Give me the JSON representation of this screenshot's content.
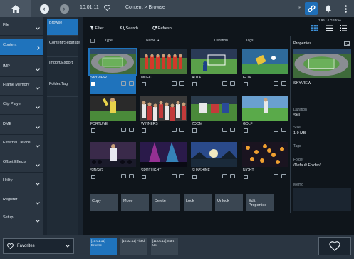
{
  "topbar": {
    "favorite_path": "10:01.11",
    "title": "Content > Browse",
    "ip_label": "IP"
  },
  "leftnav": {
    "items": [
      {
        "label": "File",
        "active": false
      },
      {
        "label": "Content",
        "active": true
      },
      {
        "label": "IMP",
        "active": false
      },
      {
        "label": "Frame Memory",
        "active": false
      },
      {
        "label": "Clip Player",
        "active": false
      },
      {
        "label": "DME",
        "active": false
      },
      {
        "label": "External Device",
        "active": false
      },
      {
        "label": "Offset Effects",
        "active": false
      },
      {
        "label": "Utility",
        "active": false
      },
      {
        "label": "Register",
        "active": false
      },
      {
        "label": "Setup",
        "active": false
      }
    ]
  },
  "subnav": {
    "items": [
      {
        "label": "Browse",
        "active": true
      },
      {
        "label": "Content/Separate",
        "active": false
      },
      {
        "label": "Import/Export",
        "active": false
      },
      {
        "label": "Folder/Tag",
        "active": false
      }
    ]
  },
  "toolbar": {
    "filter_label": "Filter",
    "search_label": "Search",
    "refresh_label": "Refresh",
    "storage_label": "1.96 / 4 GB free"
  },
  "columns": {
    "type": "Type",
    "name": "Name",
    "duration": "Duration",
    "tags": "Tags"
  },
  "tiles": [
    {
      "name": "SKYVIEW",
      "selected": true,
      "scene": "stadium"
    },
    {
      "name": "MUFC",
      "selected": false,
      "scene": "team"
    },
    {
      "name": "AUTA",
      "selected": false,
      "scene": "goal"
    },
    {
      "name": "GOAL",
      "selected": false,
      "scene": "keeper"
    },
    {
      "name": "FORTUNE",
      "selected": false,
      "scene": "cheer"
    },
    {
      "name": "WINNERS",
      "selected": false,
      "scene": "crowd"
    },
    {
      "name": "ZOOM",
      "selected": false,
      "scene": "tackle"
    },
    {
      "name": "GOLF",
      "selected": false,
      "scene": "golf"
    },
    {
      "name": "SING02",
      "selected": false,
      "scene": "singer"
    },
    {
      "name": "SPOTLIGHT",
      "selected": false,
      "scene": "concert"
    },
    {
      "name": "SUNSHINE",
      "selected": false,
      "scene": "sunshine"
    },
    {
      "name": "NIGHT",
      "selected": false,
      "scene": "lanterns"
    }
  ],
  "actions": [
    "Copy",
    "Move",
    "Delete",
    "Lock",
    "Unlock",
    "Edit Properties"
  ],
  "properties": {
    "title": "Properties",
    "name": "SKYVIEW",
    "duration_label": "Duration",
    "duration_value": "Still",
    "size_label": "Size",
    "size_value": "1.9 MB",
    "tags_label": "Tags",
    "folder_label": "Folder",
    "folder_value": "/Default Folder/",
    "memo_label": "Memo"
  },
  "bottombar": {
    "favorites_label": "Favorites",
    "recent": [
      {
        "label": "[10:01.11] Browse",
        "active": true
      },
      {
        "label": "[10:02.11] Fixed",
        "active": false
      },
      {
        "label": "[11:01.11] Start Up",
        "active": false
      }
    ]
  },
  "colors": {
    "accent": "#1f73bc",
    "panel": "#2a3541",
    "background": "#0f151b"
  },
  "icons": [
    "home-icon",
    "back-icon",
    "forward-icon",
    "heart-icon",
    "link-icon",
    "bell-icon",
    "more-icon",
    "filter-icon",
    "search-icon",
    "refresh-icon",
    "grid-view-icon",
    "list-view-icon",
    "detail-view-icon",
    "chevron-down-icon",
    "chevron-right-icon"
  ]
}
